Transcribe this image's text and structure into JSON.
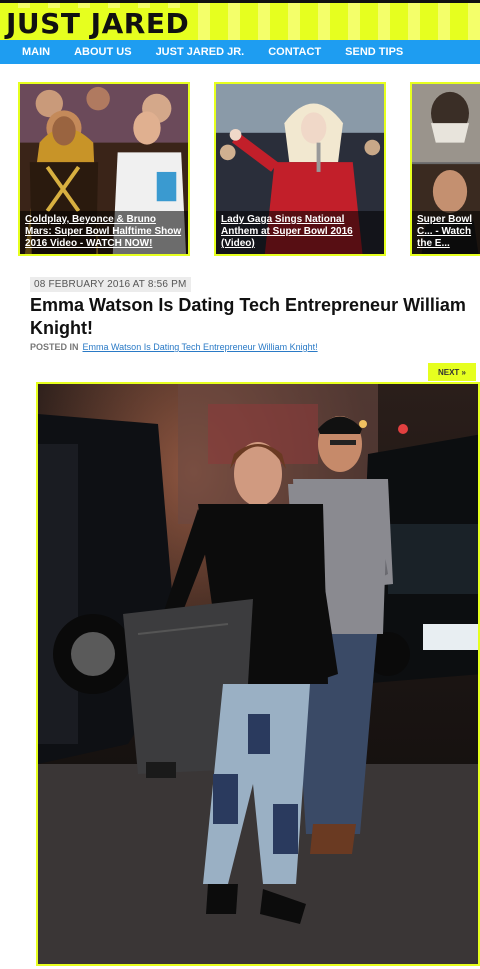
{
  "site": {
    "logo": "JUST JARED"
  },
  "nav": {
    "items": [
      {
        "label": "MAIN"
      },
      {
        "label": "ABOUT US"
      },
      {
        "label": "JUST JARED JR."
      },
      {
        "label": "CONTACT"
      },
      {
        "label": "SEND TIPS"
      }
    ]
  },
  "thumbnails": [
    {
      "caption": "Coldplay, Beyonce & Bruno Mars: Super Bowl Halftime Show 2016 Video - WATCH NOW!"
    },
    {
      "caption": "Lady Gaga Sings National Anthem at Super Bowl 2016 (Video)"
    },
    {
      "caption": "Super Bowl C... - Watch the E..."
    }
  ],
  "article": {
    "date": "08 FEBRUARY 2016 AT 8:56 PM",
    "title": "Emma Watson Is Dating Tech Entrepreneur William Knight!",
    "posted_label": "POSTED IN",
    "posted_link": "Emma Watson Is Dating Tech Entrepreneur William Knight!",
    "next_label": "NEXT »"
  },
  "colors": {
    "accent": "#e6ff1f",
    "nav": "#1e9df1",
    "link": "#2a7ac6"
  }
}
